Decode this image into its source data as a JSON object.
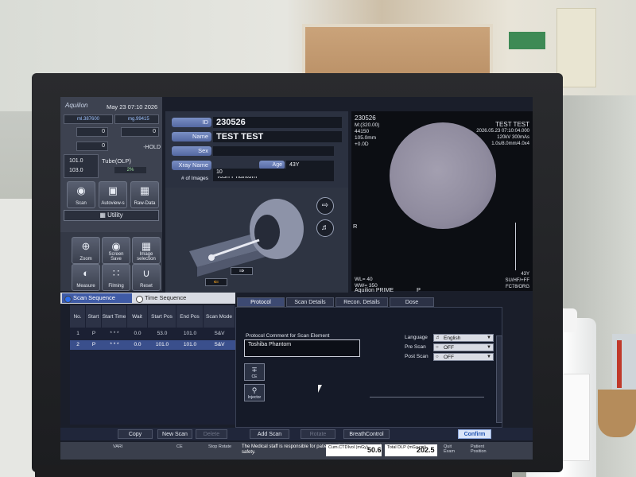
{
  "header": {
    "brand": "Aquilion",
    "datetime": "May 23 07:10 2026"
  },
  "status": {
    "counter1": "ml.387600",
    "counter2": "mg.99415",
    "field_a": "0",
    "field_b": "0",
    "field_c": "0",
    "hold": "-HOLD",
    "tube_value1": "101.0",
    "tube_value2": "103.0",
    "tube_label": "Tube(OLP)",
    "tube_percent": "2%"
  },
  "tools": {
    "scan": "Scan",
    "autoview": "Autoview-s",
    "rawdata": "Raw-Data",
    "utility": "Utility",
    "zoom": "Zoom",
    "screen_save": "Screen Save",
    "image_selection": "Image selection",
    "measure": "Measure",
    "filming": "Filming",
    "reset": "Reset"
  },
  "patient": {
    "id_label": "ID",
    "id": "230526",
    "name_label": "Name",
    "name": "TEST TEST",
    "sex_label": "Sex",
    "age_label": "Age",
    "age": "43Y",
    "xray_label": "Xray Name",
    "xray_name": "Tosh Phantom",
    "images_label": "# of Images",
    "images": "10"
  },
  "viewer": {
    "id": "230526",
    "m": "M:(320.00)",
    "line3": "44150",
    "line4": "105.0mm",
    "line5": "+0.0D",
    "name": "TEST TEST",
    "date": "2026.05.23 07:10:04.000",
    "kv": "120kV 300mAs",
    "slice": "1.0s/8.0mm/4.0x4",
    "r_marker": "R",
    "wl": "WL= 40",
    "ww": "WW= 350",
    "system": "Aquilion PRIME",
    "p_marker": "P",
    "age": "43Y",
    "code1": "SU/HF/+FF",
    "code2": "FC78/ORG"
  },
  "sequence_tabs": {
    "scan_sequence": "Scan Sequence",
    "time_sequence": "Time Sequence"
  },
  "scan_table": {
    "headers": [
      "No.",
      "Start",
      "Start Time",
      "Wait",
      "Start Pos",
      "End Pos",
      "Scan Mode"
    ],
    "rows": [
      {
        "no": "1",
        "start": "P",
        "time": "* * *",
        "wait": "0.0",
        "start_pos": "53.0",
        "end_pos": "101.0",
        "mode": "S&V"
      },
      {
        "no": "2",
        "start": "P",
        "time": "* * *",
        "wait": "0.0",
        "start_pos": "101.0",
        "end_pos": "101.0",
        "mode": "S&V"
      }
    ]
  },
  "protocol_tabs": [
    "Protocol",
    "Scan Details",
    "Recon. Details",
    "Dose"
  ],
  "protocol": {
    "comment_title": "Protocol Comment for Scan Element",
    "comment": "Toshiba Phantom",
    "language_label": "Language",
    "language_value": "English",
    "pre_scan_label": "Pre Scan",
    "pre_scan_value": "OFF",
    "post_scan_label": "Post Scan",
    "post_scan_value": "OFF",
    "ce_label": "CE",
    "injector_label": "Injector"
  },
  "actions": {
    "copy": "Copy",
    "new_scan": "New Scan",
    "delete": "Delete",
    "add_scan": "Add Scan",
    "rotate": "Rotate",
    "breath_control": "BreathControl",
    "confirm": "Confirm"
  },
  "statusbar": {
    "vari": "VARI",
    "ce": "CE",
    "stop_rotate": "Stop Rotate",
    "message": "The Medical staff is responsible for patient radiation exposure and safety.",
    "ctdi_label": "Cum.CTDIvol (mGy)",
    "ctdi": "50.6",
    "dlp_label": "Total DLP (mGy.cm)",
    "dlp": "202.5",
    "quit_exam": "Quit Exam",
    "pos_patient": "Patient Position"
  },
  "colors": {
    "accent": "#3f5ba6",
    "confirm_text": "#2456b3",
    "phantom": "#8f8b9e"
  }
}
